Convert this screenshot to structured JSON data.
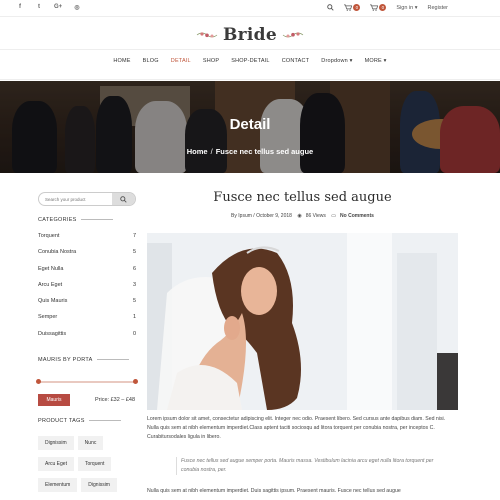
{
  "topbar": {
    "social": [
      "f",
      "t",
      "G+",
      "◎"
    ],
    "cart_count": "0",
    "wishlist_count": "0",
    "signin": "Sign in",
    "register": "Register"
  },
  "logo": {
    "text": "Bride"
  },
  "nav": {
    "items": [
      {
        "label": "HOME"
      },
      {
        "label": "BLOG"
      },
      {
        "label": "DETAIL"
      },
      {
        "label": "SHOP"
      },
      {
        "label": "SHOP-DETAIL"
      },
      {
        "label": "CONTACT"
      },
      {
        "label": "Dropdown ▾"
      },
      {
        "label": "MORE ▾"
      }
    ],
    "active": "DETAIL"
  },
  "banner": {
    "title": "Detail",
    "breadcrumb_home": "Home",
    "breadcrumb_sep": "/",
    "breadcrumb_current": "Fusce nec tellus sed augue"
  },
  "sidebar": {
    "search_placeholder": "Search your product",
    "categories_heading": "CATEGORIES",
    "categories": [
      {
        "name": "Torquent",
        "count": "7"
      },
      {
        "name": "Conubia Nostra",
        "count": "5"
      },
      {
        "name": "Eget Nulla",
        "count": "6"
      },
      {
        "name": "Arcu Eget",
        "count": "3"
      },
      {
        "name": "Quis Mauris",
        "count": "5"
      },
      {
        "name": "Semper",
        "count": "1"
      },
      {
        "name": "Duissagittis",
        "count": "0"
      }
    ],
    "price_heading": "MAURIS BY PORTA",
    "filter_button": "Mauris",
    "price_range": "Price: £32 – £48",
    "tags_heading": "PRODUCT TAGS",
    "tags": [
      "Dignissim",
      "Nunc",
      "Arcu Eget",
      "Torquent",
      "Elementum",
      "Dignissim"
    ]
  },
  "post": {
    "title": "Fusce nec tellus sed augue",
    "author_prefix": "By",
    "author": "Ipsum",
    "date": "/ October 9, 2018",
    "views": "86 Views",
    "comments": "No Comments",
    "paragraph1": "Lorem ipsum dolor sit amet, consectetur adipiscing elit. Integer nec odio. Praesent libero. Sed cursus ante dapibus diam. Sed nisi. Nulla quis sem at nibh elementum imperdiet.Class aptent taciti sociosqu ad litora torquent per conubia nostra, per inceptos C. Curabitursodales ligula in libero.",
    "quote": "Fusce nec tellus sed augue semper porta. Mauris massa. Vestibulum lacinia arcu eget nulla litora torquent per conubia nostra, per.",
    "paragraph2": "Nulla quis sem at nibh elementum imperdiet. Duis sagittis ipsum. Praesent mauris. Fusce nec tellus sed augue"
  }
}
